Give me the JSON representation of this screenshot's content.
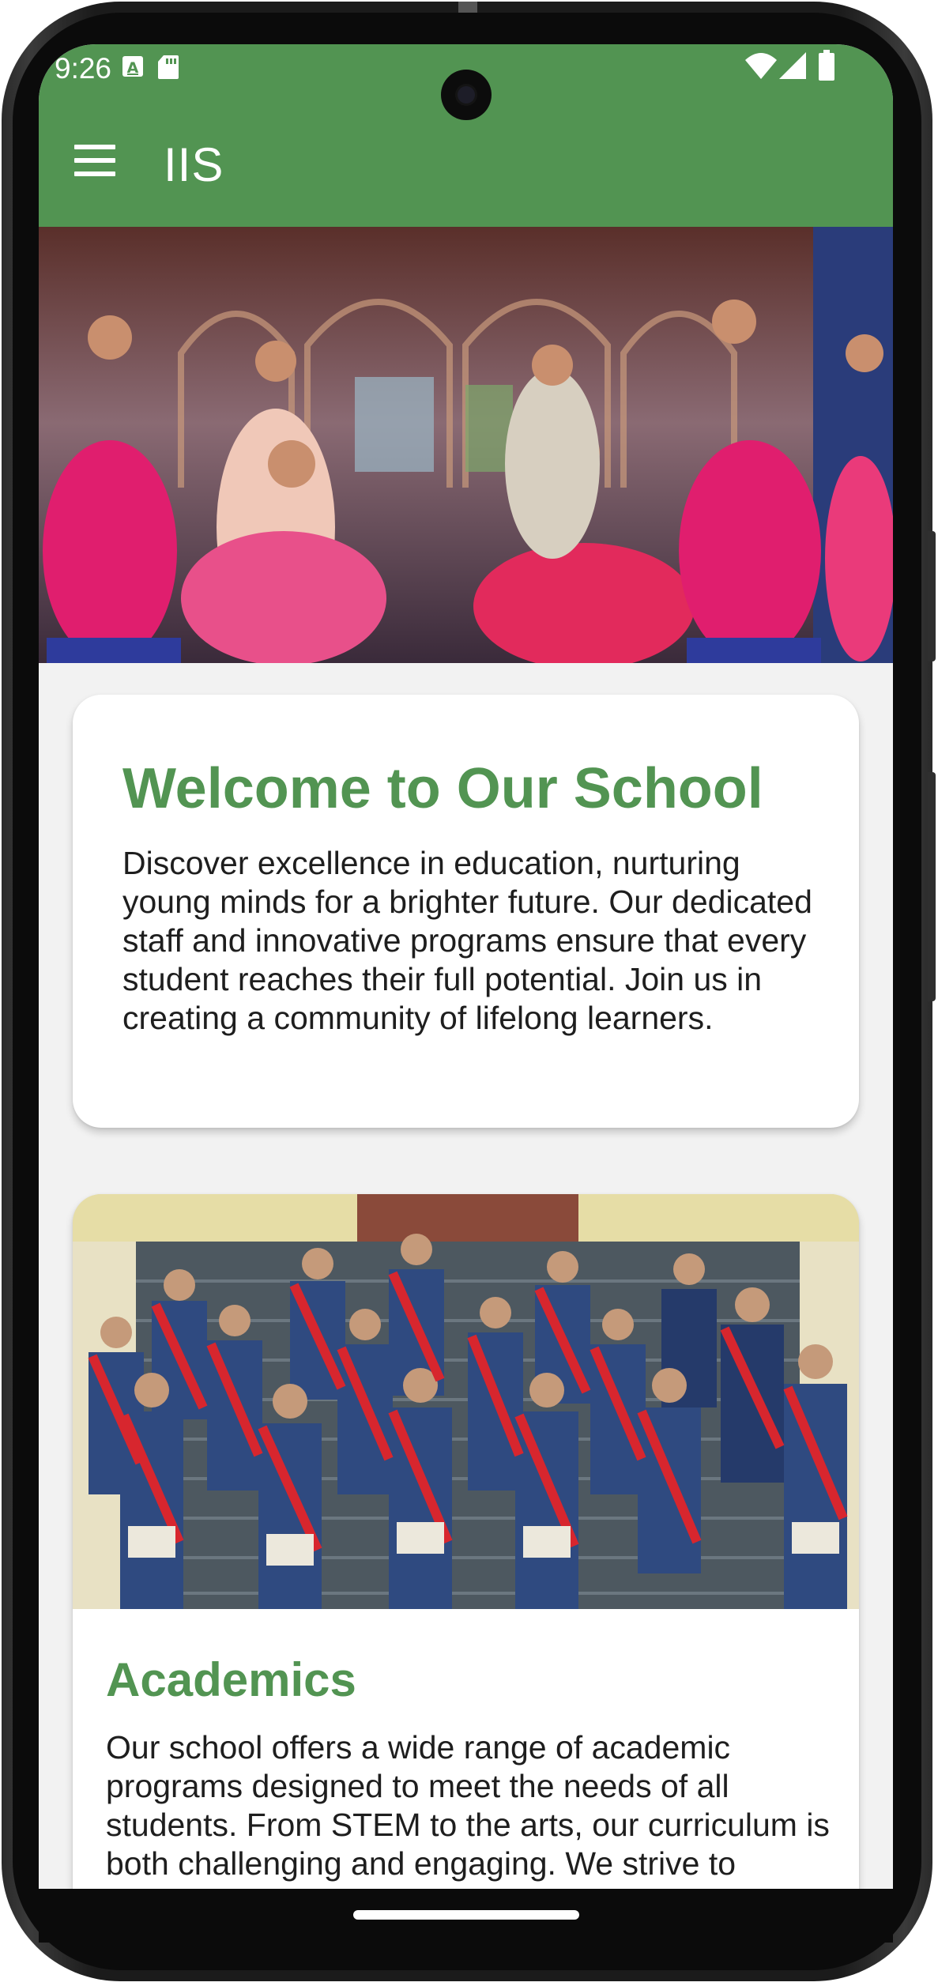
{
  "status_bar": {
    "time": "9:26",
    "left_icons": [
      "font-notification-icon",
      "sd-card-icon"
    ],
    "right_icons": [
      "wifi-icon",
      "cellular-signal-icon",
      "battery-icon"
    ]
  },
  "app_bar": {
    "menu_icon": "hamburger-menu-icon",
    "title": "IIS",
    "color": "#529452"
  },
  "hero_image": {
    "description_icon": "dancers-photo"
  },
  "welcome_card": {
    "title": "Welcome to Our School",
    "body": "Discover excellence in education, nurturing young minds for a brighter future. Our dedicated staff and innovative programs ensure that every student reaches their full potential. Join us in creating a community of lifelong learners."
  },
  "academics_card": {
    "image_icon": "students-photo",
    "title": "Academics",
    "body": "Our school offers a wide range of academic programs designed to meet the needs of all students. From STEM to the arts, our curriculum is both challenging and engaging. We strive to"
  },
  "nav_bar": {
    "home_indicator": "home-gesture-pill"
  },
  "colors": {
    "accent": "#529452",
    "background": "#f2f2f2",
    "card": "#ffffff",
    "text": "#1e1e1e"
  }
}
